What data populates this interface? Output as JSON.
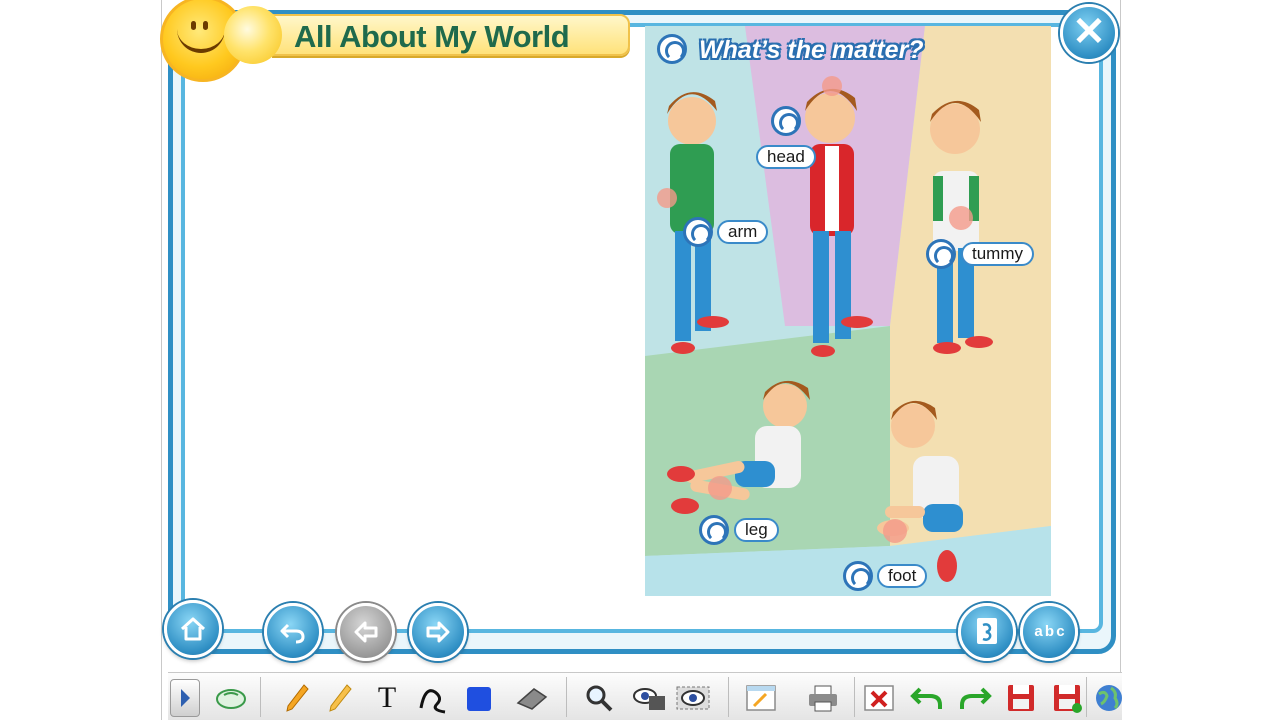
{
  "app": {
    "title": "All About My World",
    "close_label": "✕"
  },
  "scene": {
    "heading": "What’s the matter?",
    "words": [
      {
        "label": "head"
      },
      {
        "label": "arm"
      },
      {
        "label": "tummy"
      },
      {
        "label": "leg"
      },
      {
        "label": "foot"
      }
    ]
  },
  "nav": {
    "home_icon": "home-icon",
    "undo_icon": "undo-icon",
    "back_icon": "arrow-left-icon",
    "forward_icon": "arrow-right-icon",
    "glossary_icon": "glossary-icon",
    "abc_icon": "abc-icon",
    "abc_label": "a b c"
  },
  "toolbar": {
    "text_tool_label": "T",
    "tools": [
      "toggle-panel-icon",
      "mouse-icon",
      "pencil-icon",
      "highlighter-icon",
      "text-icon",
      "curve-icon",
      "shape-icon",
      "eraser-icon",
      "zoom-icon",
      "reveal-icon",
      "spotlight-icon",
      "whiteboard-icon",
      "print-icon",
      "clear-icon",
      "undo-icon",
      "redo-icon",
      "save-icon",
      "save-as-icon",
      "globe-icon"
    ]
  },
  "colors": {
    "frame": "#2f8fc4",
    "title_text": "#1f6a4c",
    "title_bg": "#ffe27a"
  }
}
